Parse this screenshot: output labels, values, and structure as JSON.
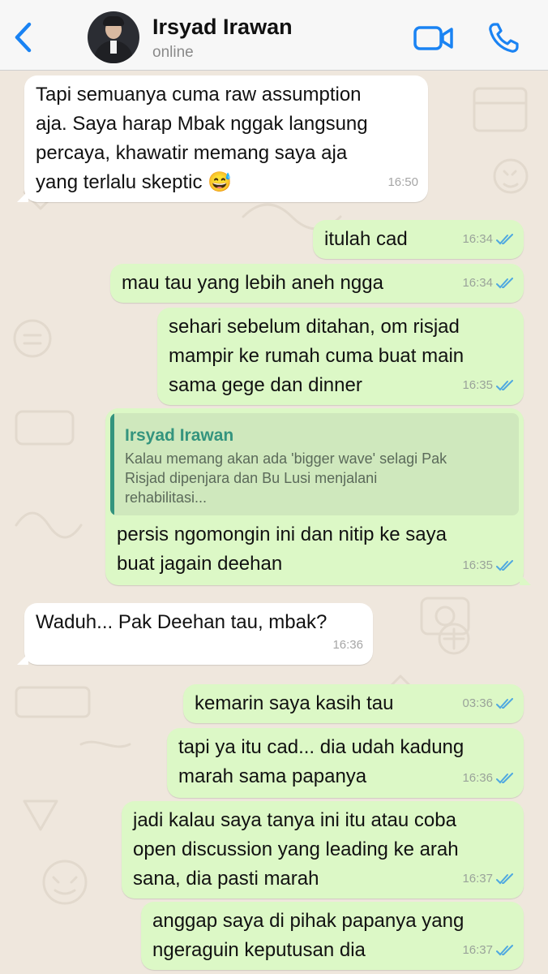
{
  "header": {
    "contact_name": "Irsyad Irawan",
    "status": "online",
    "icons": [
      "back-chevron-icon",
      "video-camera-icon",
      "phone-icon"
    ],
    "accent_color": "#1a83f3"
  },
  "messages": [
    {
      "direction": "in",
      "lines": [
        "Tapi semuanya cuma raw assumption",
        "aja. Saya harap Mbak nggak langsung",
        "percaya, khawatir memang saya aja",
        "yang terlalu skeptic 😅"
      ],
      "time": "16:50"
    },
    {
      "direction": "out",
      "lines": [
        "itulah cad"
      ],
      "time": "16:34",
      "read": true
    },
    {
      "direction": "out",
      "lines": [
        "mau tau yang lebih aneh ngga"
      ],
      "time": "16:34",
      "read": true
    },
    {
      "direction": "out",
      "lines": [
        "sehari sebelum ditahan, om risjad",
        "mampir ke rumah cuma buat main",
        "sama gege dan dinner"
      ],
      "time": "16:35",
      "read": true
    },
    {
      "direction": "out",
      "quote": {
        "author": "Irsyad Irawan",
        "lines": [
          "Kalau memang akan ada 'bigger wave' selagi Pak",
          "Risjad dipenjara dan Bu Lusi menjalani",
          "rehabilitasi..."
        ]
      },
      "lines": [
        "persis ngomongin ini dan nitip ke saya",
        "buat jagain deehan"
      ],
      "time": "16:35",
      "read": true
    },
    {
      "direction": "in",
      "lines": [
        "Waduh... Pak Deehan tau, mbak?"
      ],
      "time": "16:36"
    },
    {
      "direction": "out",
      "lines": [
        "kemarin saya kasih tau"
      ],
      "time": "03:36",
      "read": true
    },
    {
      "direction": "out",
      "lines": [
        "tapi ya itu cad... dia udah kadung",
        "marah sama papanya"
      ],
      "time": "16:36",
      "read": true
    },
    {
      "direction": "out",
      "lines": [
        "jadi kalau saya tanya ini itu atau coba",
        "open discussion yang leading ke arah",
        "sana, dia pasti marah"
      ],
      "time": "16:37",
      "read": true
    },
    {
      "direction": "out",
      "lines": [
        "anggap saya di pihak papanya yang",
        "ngeraguin keputusan dia"
      ],
      "time": "16:37",
      "read": true
    }
  ],
  "colors": {
    "incoming_bubble": "#ffffff",
    "outgoing_bubble": "#dcf8c6",
    "quote_accent": "#34947e",
    "read_ticks": "#4fa8e0",
    "wallpaper": "#efe7dd"
  }
}
